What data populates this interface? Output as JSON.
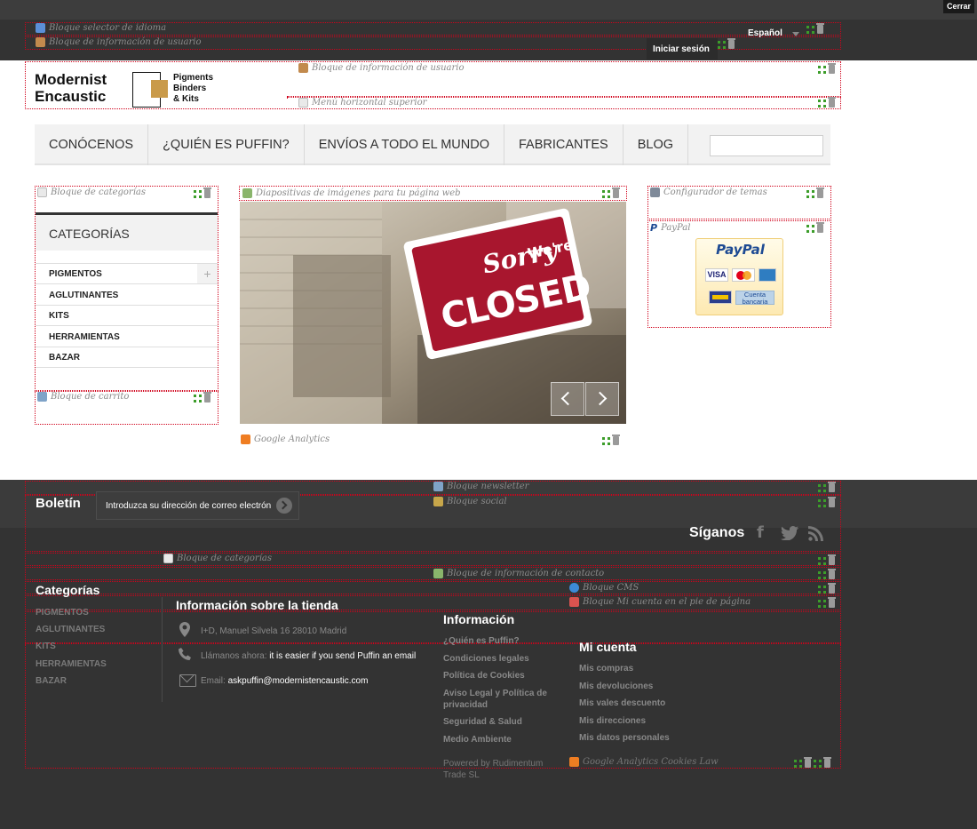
{
  "topbar": {
    "close_label": "Cerrar"
  },
  "header": {
    "language": "Español",
    "login_label": "Iniciar sesión",
    "logo_line1": "Modernist",
    "logo_line2": "Encaustic",
    "logo_sub1": "Pigments",
    "logo_sub2": "Binders",
    "logo_sub3": "& Kits"
  },
  "hooks": {
    "lang_selector": "Bloque selector de idioma",
    "user_info_top": "Bloque de información de usuario",
    "user_info_header": "Bloque de información de usuario",
    "top_menu": "Menú horizontal superior",
    "categories": "Bloque de categorías",
    "slideshow": "Diapositivas de imágenes para tu página web",
    "theme_config": "Configurador de temas",
    "paypal": "PayPal",
    "cart": "Bloque de carrito",
    "analytics": "Google Analytics",
    "newsletter": "Bloque newsletter",
    "social": "Bloque social",
    "footer_categories": "Bloque de categorías",
    "contact_info": "Bloque de información de contacto",
    "cms": "Bloque CMS",
    "my_account_footer": "Bloque Mi cuenta en el pie de página",
    "footer_overlap": "Google Analytics Cookies Law"
  },
  "nav": {
    "items": [
      "CONÓCENOS",
      "¿QUIÉN ES PUFFIN?",
      "ENVÍOS A TODO EL MUNDO",
      "FABRICANTES",
      "BLOG"
    ]
  },
  "categories": {
    "title": "CATEGORÍAS",
    "items": [
      "PIGMENTOS",
      "AGLUTINANTES",
      "KITS",
      "HERRAMIENTAS",
      "BAZAR"
    ]
  },
  "slideshow": {
    "sign_word1": "Sorry",
    "sign_word2": "We're",
    "sign_word3": "CLOSED"
  },
  "paypal": {
    "brand": "PayPal",
    "visa": "VISA",
    "bank_label_1": "Cuenta",
    "bank_label_2": "bancaria"
  },
  "footer": {
    "newsletter_title": "Boletín",
    "newsletter_placeholder": "Introduzca su dirección de correo electrón",
    "follow_us": "Síganos",
    "categories_title": "Categorías",
    "categories": [
      "PIGMENTOS",
      "AGLUTINANTES",
      "KITS",
      "HERRAMIENTAS",
      "BAZAR"
    ],
    "store_info_title": "Información sobre la tienda",
    "address": "I+D, Manuel Silvela 16 28010 Madrid",
    "call_label": "Llámanos ahora:",
    "call_value": "it is easier if you send Puffin an email",
    "email_label": "Email:",
    "email_value": "askpuffin@modernistencaustic.com",
    "info_title": "Información",
    "info_links": [
      "¿Quién es Puffin?",
      "Condiciones legales",
      "Política de Cookies",
      "Aviso Legal y Política de",
      "privacidad",
      "Seguridad & Salud",
      "Medio Ambiente"
    ],
    "powered_1": "Powered by Rudimentum",
    "powered_2": "Trade SL",
    "account_title": "Mi cuenta",
    "account_links": [
      "Mis compras",
      "Mis devoluciones",
      "Mis vales descuento",
      "Mis direcciones",
      "Mis datos personales"
    ]
  },
  "colors": {
    "accent": "#d0021b",
    "dark_bg": "#333333",
    "sign_red": "#a8162e"
  }
}
